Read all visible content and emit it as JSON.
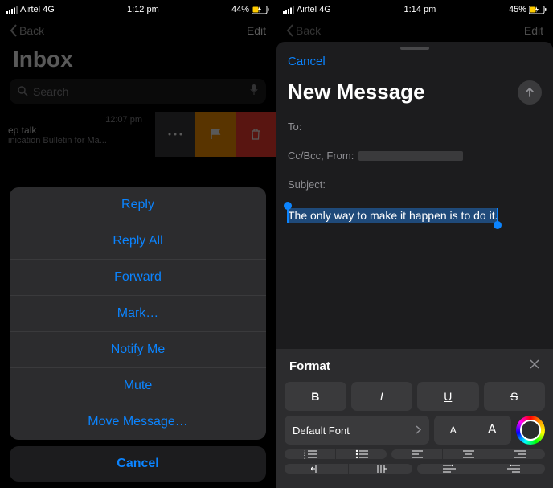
{
  "left": {
    "status": {
      "carrier": "Airtel 4G",
      "time": "1:12 pm",
      "battery": "44%"
    },
    "nav": {
      "back": "Back",
      "edit": "Edit"
    },
    "title": "Inbox",
    "search_placeholder": "Search",
    "message": {
      "time": "12:07 pm",
      "subject": "ep talk",
      "preview": "inication Bulletin for Ma..."
    },
    "sheet": {
      "items": [
        "Reply",
        "Reply All",
        "Forward",
        "Mark…",
        "Notify Me",
        "Mute",
        "Move Message…"
      ],
      "cancel": "Cancel"
    }
  },
  "right": {
    "status": {
      "carrier": "Airtel 4G",
      "time": "1:14 pm",
      "battery": "45%"
    },
    "nav": {
      "back": "Back",
      "edit": "Edit"
    },
    "compose": {
      "cancel": "Cancel",
      "title": "New Message",
      "to_label": "To:",
      "ccbcc_label": "Cc/Bcc, From:",
      "subject_label": "Subject:",
      "body_selected": "The only way to make it happen is to do it."
    },
    "format": {
      "title": "Format",
      "bold": "B",
      "italic": "I",
      "underline": "U",
      "strike": "S",
      "font_label": "Default Font",
      "small_a": "A",
      "big_a": "A"
    }
  },
  "colors": {
    "ios_blue": "#0b84ff",
    "sheet_bg": "#2c2c2e",
    "btn_bg": "#3a3a3c"
  }
}
